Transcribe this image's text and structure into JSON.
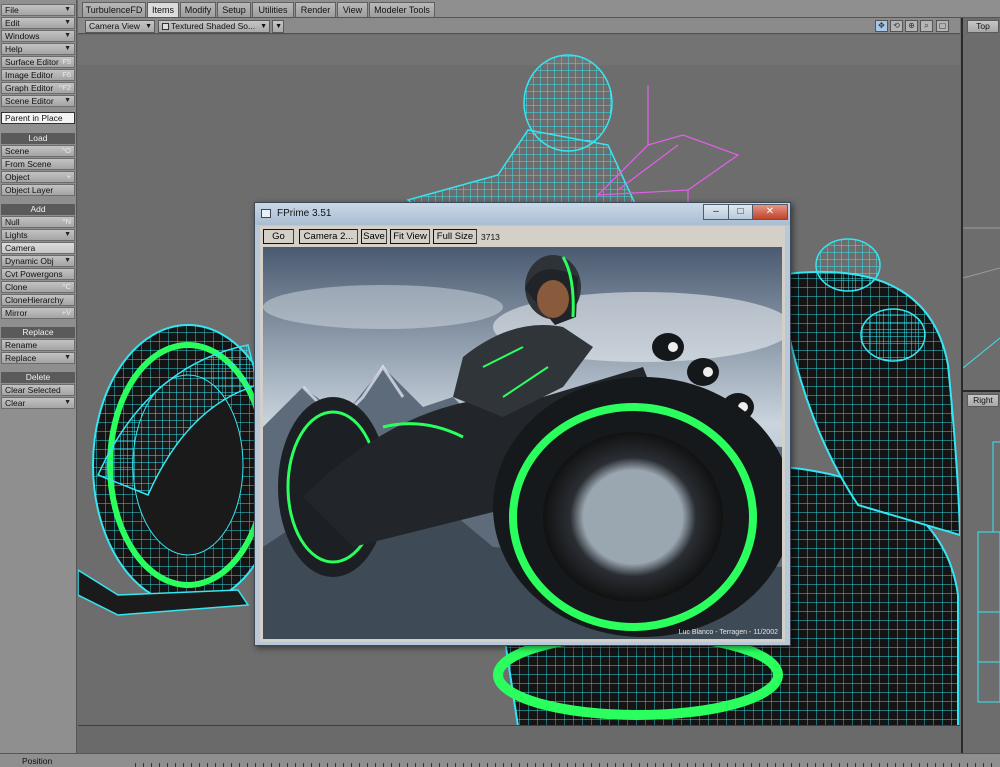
{
  "left_toolbar": {
    "top_buttons": [
      {
        "label": "File",
        "arrow": "▼"
      },
      {
        "label": "Edit",
        "arrow": "▼"
      },
      {
        "label": "Windows",
        "arrow": "▼"
      },
      {
        "label": "Help",
        "arrow": "▼"
      },
      {
        "label": "Surface Editor",
        "shortcut": "F5"
      },
      {
        "label": "Image Editor",
        "shortcut": "F6"
      },
      {
        "label": "Graph Editor",
        "shortcut": "^F2"
      },
      {
        "label": "Scene Editor",
        "arrow": "▼"
      }
    ],
    "parent_in_place": "Parent in Place",
    "load": {
      "heading": "Load",
      "items": [
        {
          "label": "Scene",
          "shortcut": "^O"
        },
        {
          "label": "From Scene"
        },
        {
          "label": "Object",
          "shortcut": "+"
        },
        {
          "label": "Object Layer"
        }
      ]
    },
    "add": {
      "heading": "Add",
      "items": [
        {
          "label": "Null",
          "shortcut": "^N"
        },
        {
          "label": "Lights",
          "arrow": "▼"
        },
        {
          "label": "Camera"
        },
        {
          "label": "Dynamic Obj",
          "arrow": "▼"
        },
        {
          "label": "Cvt Powergons"
        },
        {
          "label": "Clone",
          "shortcut": "^C"
        },
        {
          "label": "CloneHierarchy"
        },
        {
          "label": "Mirror",
          "shortcut": "+V"
        }
      ]
    },
    "replace": {
      "heading": "Replace",
      "items": [
        {
          "label": "Rename"
        },
        {
          "label": "Replace",
          "arrow": "▼"
        }
      ]
    },
    "delete": {
      "heading": "Delete",
      "items": [
        {
          "label": "Clear Selected"
        },
        {
          "label": "Clear",
          "arrow": "▼"
        }
      ]
    }
  },
  "tabs": [
    "TurbulenceFD",
    "Items",
    "Modify",
    "Setup",
    "Utilities",
    "Render",
    "View",
    "Modeler Tools"
  ],
  "active_tab": "Items",
  "viewport": {
    "view_label": "Camera View",
    "shading_label": "Textured Shaded So...",
    "arrow": "▼",
    "right_views": [
      "Top",
      "Right"
    ]
  },
  "fprime": {
    "title": "FPrime 3.51",
    "buttons": [
      "Go",
      "Camera 2...",
      "Save",
      "Fit View",
      "Full Size"
    ],
    "count": "3713",
    "credit": "Luc Blanco - Terragen - 11/2002",
    "controls": {
      "minimize": "–",
      "maximize": "□",
      "close": "✕"
    }
  },
  "status": {
    "position_label": "Position"
  },
  "colors": {
    "wireframe": "#35e6f2",
    "glow_green": "#2bff5e",
    "bone_magenta": "#e060e8"
  }
}
